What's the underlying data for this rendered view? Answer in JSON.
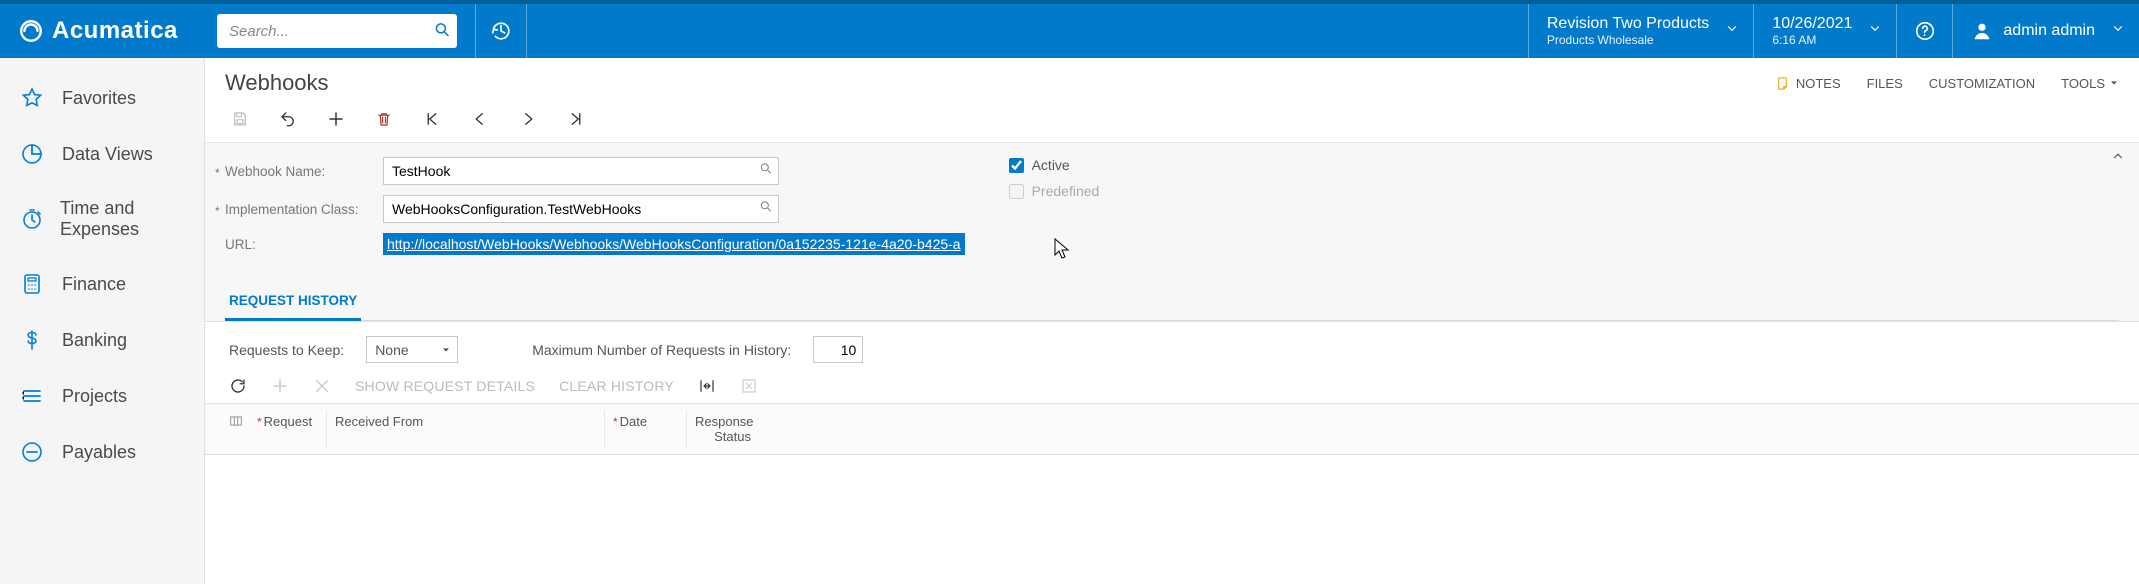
{
  "brand": {
    "name": "Acumatica"
  },
  "search": {
    "placeholder": "Search..."
  },
  "tenant": {
    "name": "Revision Two Products",
    "sub": "Products Wholesale"
  },
  "datetime": {
    "date": "10/26/2021",
    "time": "6:16 AM"
  },
  "user": {
    "name": "admin admin"
  },
  "sidebar": {
    "items": [
      {
        "label": "Favorites"
      },
      {
        "label": "Data Views"
      },
      {
        "label": "Time and Expenses"
      },
      {
        "label": "Finance"
      },
      {
        "label": "Banking"
      },
      {
        "label": "Projects"
      },
      {
        "label": "Payables"
      }
    ]
  },
  "page": {
    "title": "Webhooks"
  },
  "title_actions": {
    "notes": "NOTES",
    "files": "FILES",
    "customization": "CUSTOMIZATION",
    "tools": "TOOLS"
  },
  "form": {
    "labels": {
      "name": "Webhook Name:",
      "impl": "Implementation Class:",
      "url": "URL:",
      "active": "Active",
      "predefined": "Predefined"
    },
    "name_value": "TestHook",
    "impl_value": "WebHooksConfiguration.TestWebHooks",
    "url_value": "http://localhost/WebHooks/Webhooks/WebHooksConfiguration/0a152235-121e-4a20-b425-a",
    "active_checked": true,
    "predefined_checked": false
  },
  "tabs": {
    "history": "REQUEST HISTORY"
  },
  "gridbar": {
    "requests_to_keep_label": "Requests to Keep:",
    "requests_to_keep_value": "None",
    "max_label": "Maximum Number of Requests in History:",
    "max_value": "10"
  },
  "grid_toolbar": {
    "show_details": "SHOW REQUEST DETAILS",
    "clear_history": "CLEAR HISTORY"
  },
  "grid_headers": {
    "request": "Request",
    "received_from": "Received From",
    "date": "Date",
    "response_status": "Response Status"
  }
}
